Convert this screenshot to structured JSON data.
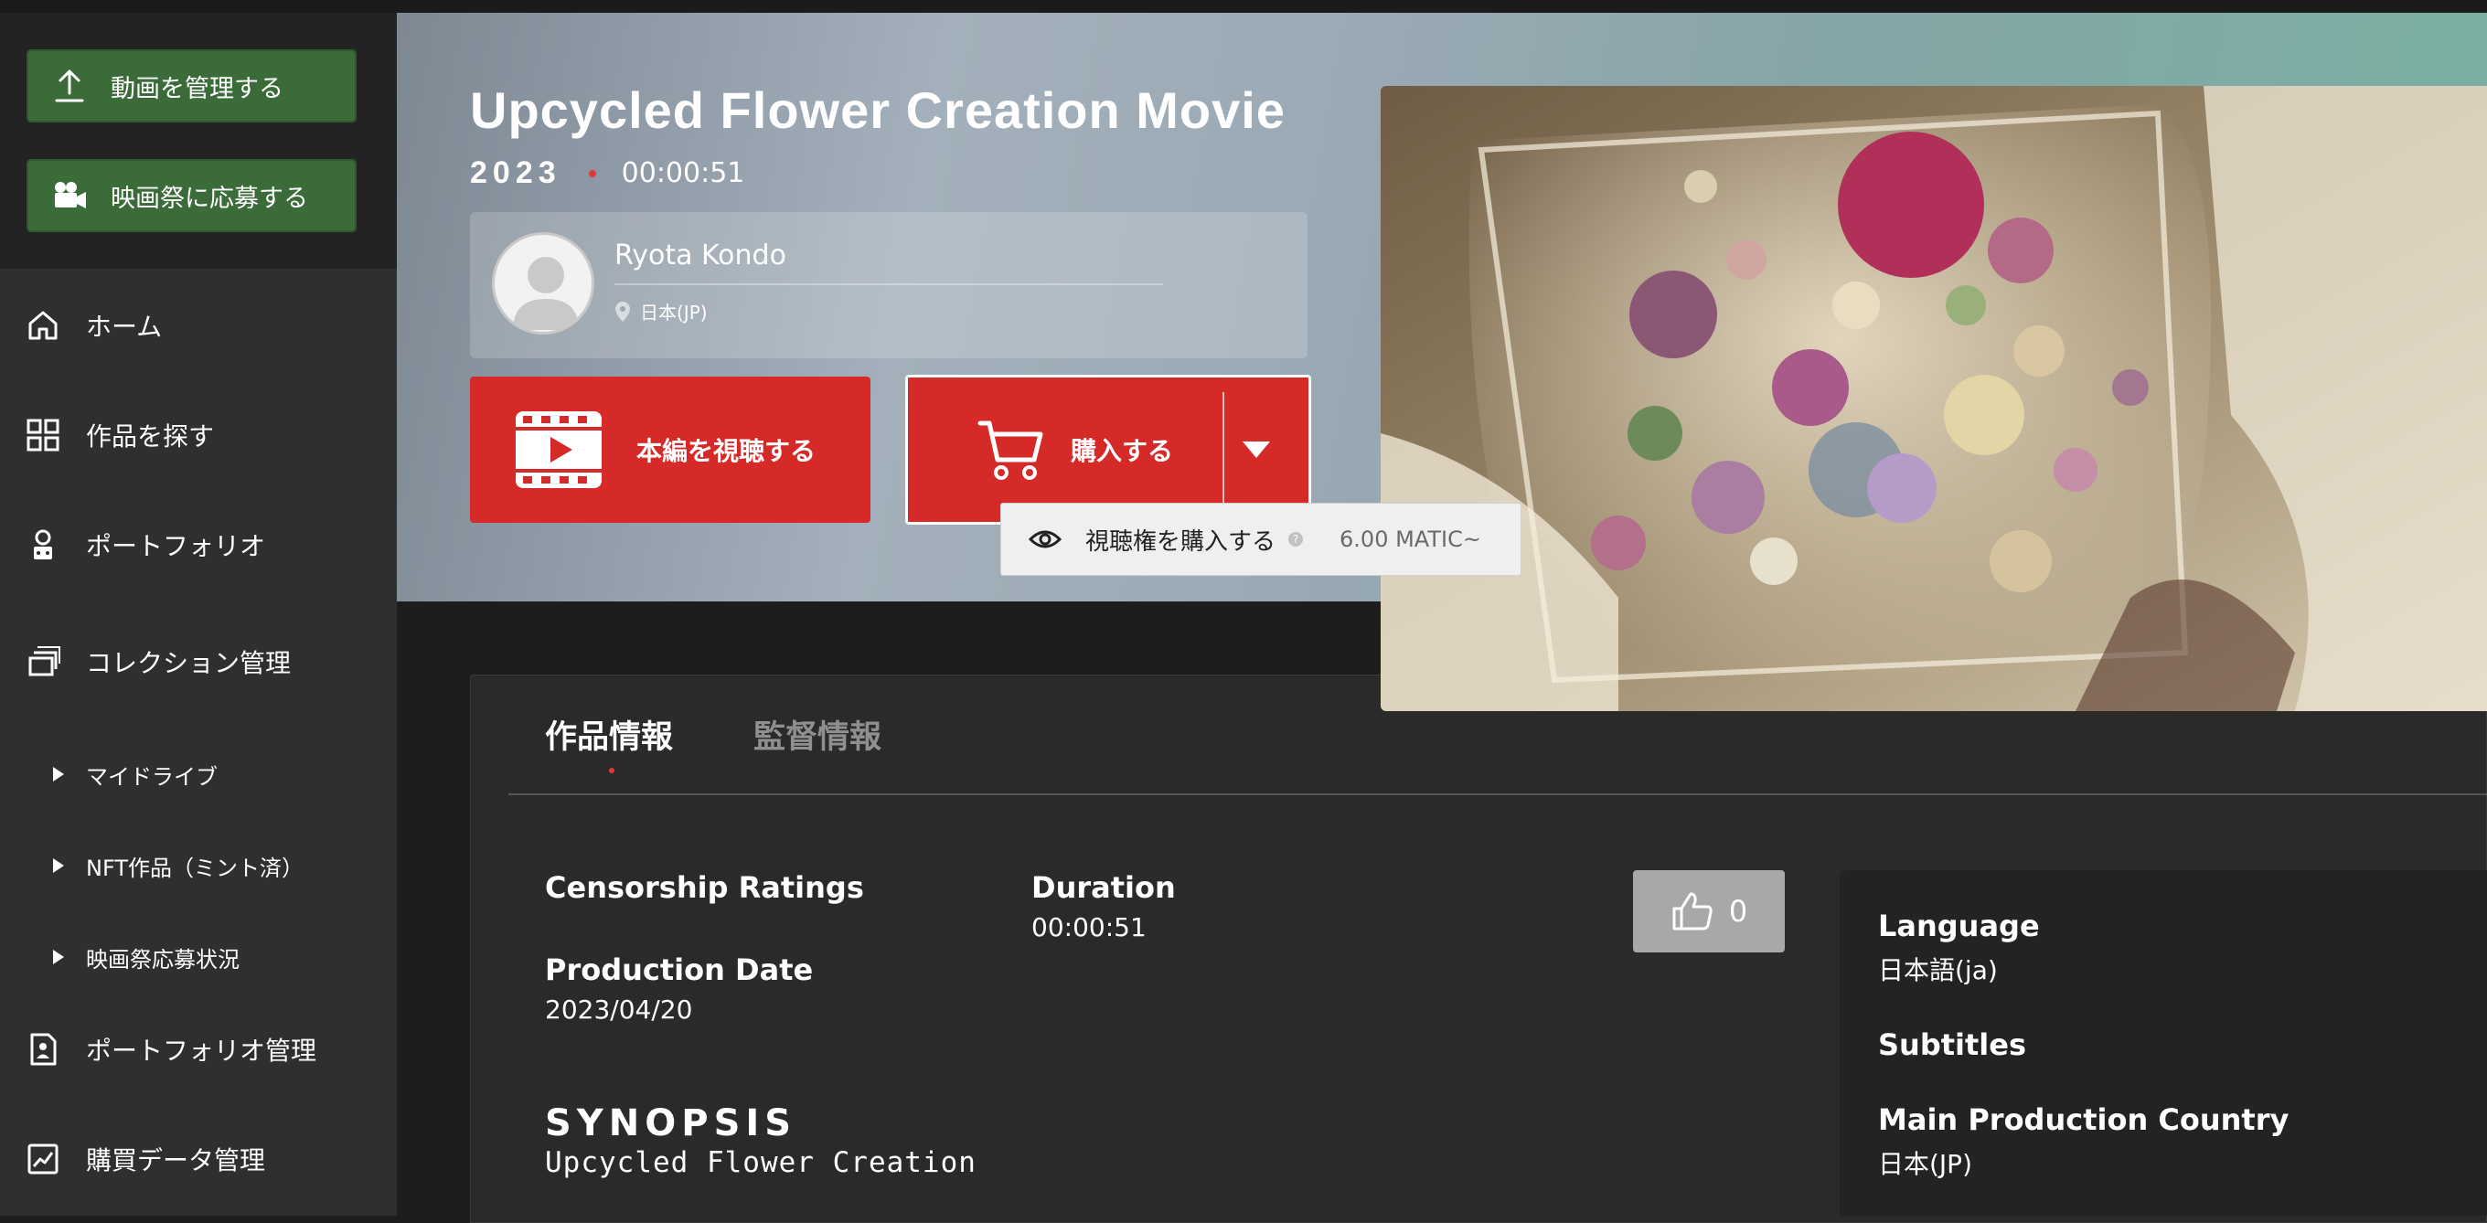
{
  "sidebar": {
    "actions": [
      {
        "label": "動画を管理する",
        "icon": "upload-icon"
      },
      {
        "label": "映画祭に応募する",
        "icon": "video-camera-icon"
      }
    ],
    "nav": [
      {
        "label": "ホーム",
        "icon": "home-icon"
      },
      {
        "label": "作品を探す",
        "icon": "grid-icon"
      },
      {
        "label": "ポートフォリオ",
        "icon": "portfolio-icon"
      },
      {
        "label": "コレクション管理",
        "icon": "collection-icon"
      }
    ],
    "sub_items": [
      "マイドライブ",
      "NFT作品（ミント済）",
      "映画祭応募状況"
    ],
    "nav_bottom": [
      {
        "label": "ポートフォリオ管理",
        "icon": "document-icon"
      },
      {
        "label": "購買データ管理",
        "icon": "chart-icon"
      }
    ]
  },
  "movie": {
    "title": "Upcycled Flower Creation Movie",
    "year": "2023",
    "duration": "00:00:51"
  },
  "author": {
    "name": "Ryota Kondo",
    "location": "日本(JP)"
  },
  "buttons": {
    "watch": "本編を視聴する",
    "buy": "購入する"
  },
  "dropdown": {
    "item_bold": "視聴権",
    "item_rest": " を購入する",
    "help": "?",
    "price": "6.00 MATIC~"
  },
  "tabs": [
    "作品情報",
    "監督情報"
  ],
  "details": {
    "censorship_label": "Censorship Ratings",
    "duration_label": "Duration",
    "duration_value": "00:00:51",
    "production_date_label": "Production Date",
    "production_date_value": "2023/04/20",
    "likes": "0"
  },
  "side_info": {
    "language_label": "Language",
    "language_value": "日本語(ja)",
    "subtitles_label": "Subtitles",
    "country_label": "Main Production Country",
    "country_value": "日本(JP)"
  },
  "synopsis": {
    "heading": "SYNOPSIS",
    "text": "Upcycled Flower Creation"
  },
  "colors": {
    "accent_red": "#d52a27",
    "action_green": "#3a6b38",
    "sidebar": "#2f2f2f",
    "panel": "#2a2a2a"
  }
}
